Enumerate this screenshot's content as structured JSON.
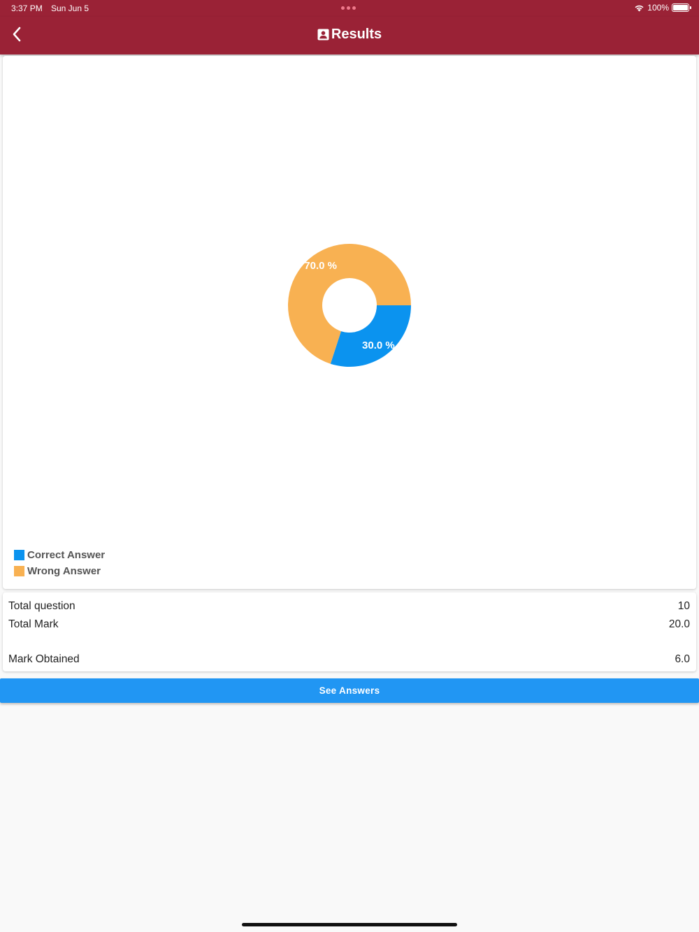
{
  "status_bar": {
    "time": "3:37 PM",
    "date": "Sun Jun 5",
    "battery": "100%"
  },
  "header": {
    "title": "Results",
    "title_icon": "account-box-icon",
    "back_icon": "chevron-left-icon"
  },
  "chart_data": {
    "type": "pie",
    "hole": true,
    "slices": [
      {
        "name": "Correct Answer",
        "value": 30.0,
        "label": "30.0 %",
        "color": "#0b93ef"
      },
      {
        "name": "Wrong Answer",
        "value": 70.0,
        "label": "70.0 %",
        "color": "#f8b152"
      }
    ],
    "legend": [
      "Correct Answer",
      "Wrong Answer"
    ],
    "legend_position": "bottom-left"
  },
  "stats": {
    "total_question_label": "Total question",
    "total_question_value": "10",
    "total_mark_label": "Total Mark",
    "total_mark_value": "20.0",
    "mark_obtained_label": "Mark Obtained",
    "mark_obtained_value": "6.0"
  },
  "actions": {
    "see_answers_label": "See Answers"
  },
  "colors": {
    "app_bar": "#9a2236",
    "button": "#2196f3",
    "correct": "#0b93ef",
    "wrong": "#f8b152"
  }
}
